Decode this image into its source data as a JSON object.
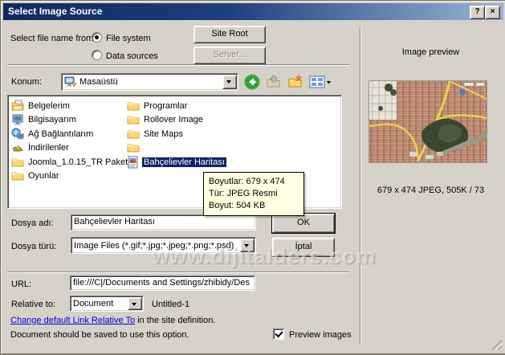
{
  "window": {
    "title": "Select Image Source",
    "help_glyph": "?",
    "close_glyph": "×"
  },
  "source_section": {
    "label": "Select file name from:",
    "radio_file_system": "File system",
    "radio_data_sources": "Data sources",
    "site_root_button": "Site Root",
    "server_button": "Server..."
  },
  "location_bar": {
    "label": "Konum:",
    "value": "Masaüstü"
  },
  "file_list": {
    "left_column": [
      {
        "label": "Belgelerim",
        "icon": "my-documents-icon"
      },
      {
        "label": "Bilgisayarım",
        "icon": "my-computer-icon"
      },
      {
        "label": "Ağ Bağlantılarım",
        "icon": "network-places-icon"
      },
      {
        "label": "İndirilenler",
        "icon": "downloads-icon"
      },
      {
        "label": "Joomla_1.0.15_TR Paket",
        "icon": "folder-icon"
      },
      {
        "label": "Oyunlar",
        "icon": "folder-icon"
      }
    ],
    "right_column": [
      {
        "label": "Programlar",
        "icon": "folder-icon"
      },
      {
        "label": "Rollover Image",
        "icon": "folder-icon"
      },
      {
        "label": "Site Maps",
        "icon": "folder-icon"
      },
      {
        "label": "",
        "icon": "folder-icon"
      },
      {
        "label": "Bahçelievler Haritası",
        "icon": "image-file-icon",
        "selected": true
      }
    ]
  },
  "tooltip": {
    "line1": "Boyutlar: 679 x 474",
    "line2": "Tür: JPEG Resmi",
    "line3": "Boyut: 504 KB"
  },
  "file_name": {
    "label": "Dosya adı:",
    "value": "Bahçelievler Haritası"
  },
  "file_type": {
    "label": "Dosya türü:",
    "value": "Image Files (*.gif;*.jpg;*.jpeg;*.png;*.psd)"
  },
  "buttons": {
    "ok": "OK",
    "cancel": "İptal"
  },
  "url_section": {
    "label": "URL:",
    "value": "file:///C|/Documents and Settings/zhibidy/Des"
  },
  "relative_section": {
    "label": "Relative to:",
    "value": "Document",
    "document_name": "Untitled-1"
  },
  "footer": {
    "link_text": "Change default Link Relative To",
    "link_suffix": " in the site definition.",
    "note": "Document should be saved to use this option.",
    "preview_checkbox_label": "Preview images",
    "preview_checked": true
  },
  "preview_panel": {
    "title": "Image preview",
    "info": "679 x 474 JPEG, 505K / 73"
  },
  "watermark": "www.dijitalders.com",
  "icons": [
    "desktop-icon",
    "back-icon",
    "up-folder-icon",
    "new-folder-icon",
    "views-icon",
    "folder-icon",
    "my-documents-icon",
    "my-computer-icon",
    "network-places-icon",
    "downloads-icon",
    "image-file-icon",
    "help-icon",
    "close-icon"
  ],
  "colors": {
    "titlebar_start": "#10295e",
    "titlebar_end": "#9bb4d6",
    "dialog_bg": "#d6d2c9",
    "selection_bg": "#0a246a",
    "tooltip_bg": "#ffffe1",
    "link_color": "#0000d4"
  }
}
